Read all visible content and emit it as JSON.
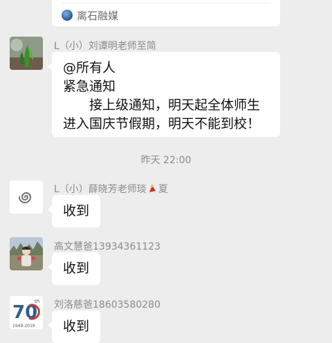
{
  "top_card": {
    "source": "离石融媒",
    "icon": "media-source-icon"
  },
  "messages": [
    {
      "sender": "L（小）刘谭明老师至简",
      "lines": [
        "@所有人",
        "紧急通知",
        "　　接上级通知，明天起全体师生",
        "进入国庆节假期，明天不能到校！"
      ]
    }
  ],
  "timestamp": "昨天 22:00",
  "replies": [
    {
      "sender": "L（小）薛晓芳老师琰",
      "sender_suffix": "夏",
      "text": "收到"
    },
    {
      "sender": "高文慧爸13934361123",
      "text": "收到"
    },
    {
      "sender": "刘洛慈爸18603580280",
      "text": "收到"
    }
  ],
  "avatar4": {
    "badge": "70",
    "sup": "th",
    "years": "1949-2019"
  }
}
